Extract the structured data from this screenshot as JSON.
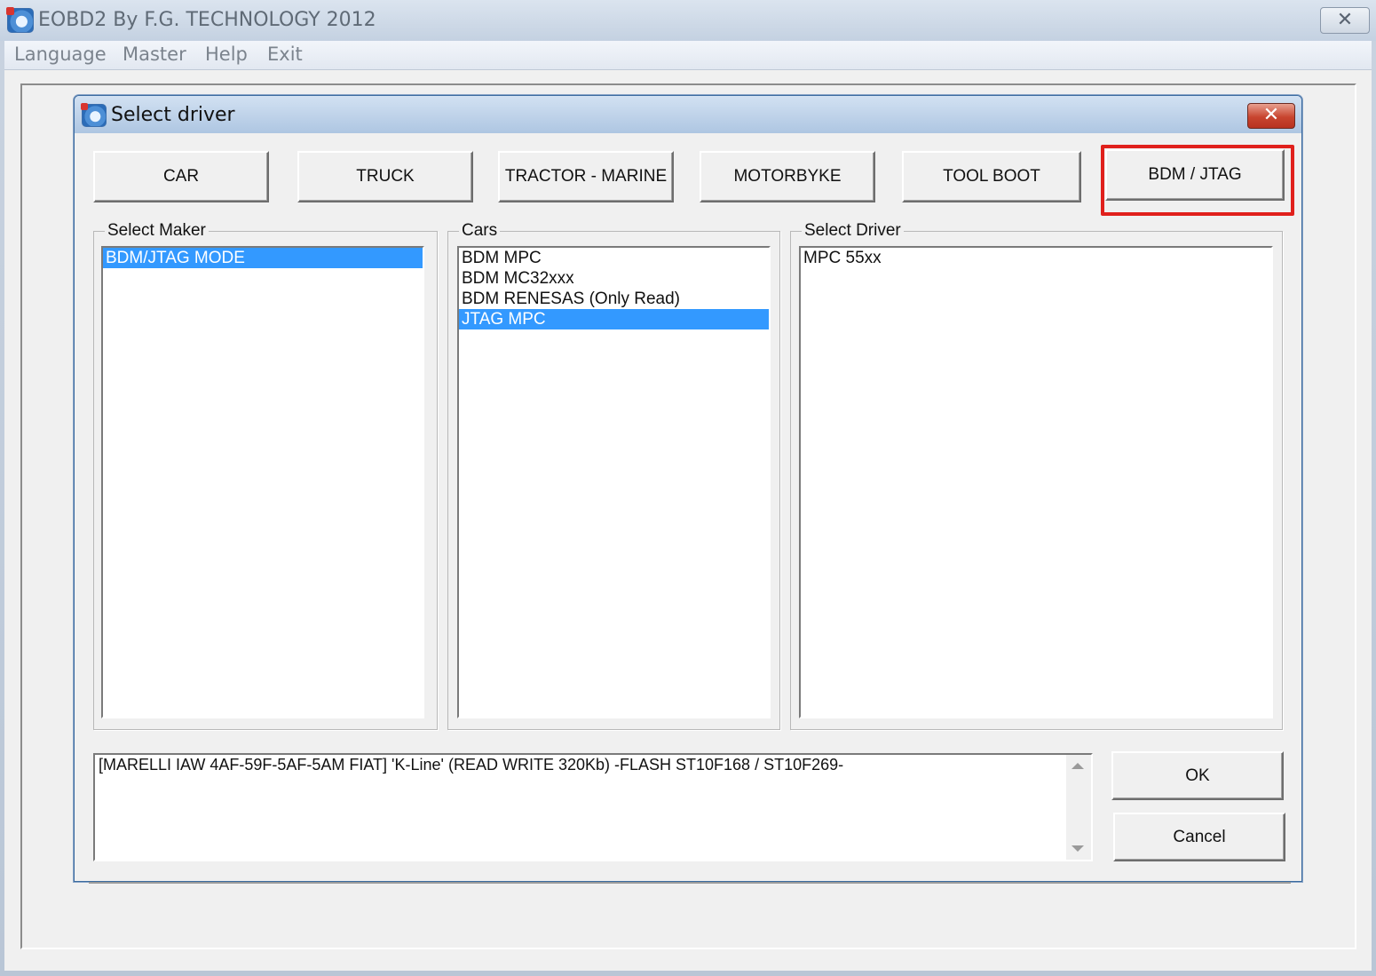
{
  "window": {
    "title": "EOBD2 By F.G. TECHNOLOGY 2012",
    "close_glyph": "✕"
  },
  "menu": {
    "items": [
      {
        "label": "Language"
      },
      {
        "label": "Master"
      },
      {
        "label": "Help"
      },
      {
        "label": "Exit"
      }
    ]
  },
  "dialog": {
    "title": "Select driver",
    "close_glyph": "✕",
    "category_buttons": [
      {
        "label": "CAR"
      },
      {
        "label": "TRUCK"
      },
      {
        "label": "TRACTOR - MARINE"
      },
      {
        "label": "MOTORBYKE"
      },
      {
        "label": "TOOL BOOT"
      },
      {
        "label": "BDM / JTAG",
        "highlighted": true
      }
    ],
    "maker_group": {
      "label": "Select Maker",
      "items": [
        {
          "label": "BDM/JTAG  MODE",
          "selected": true
        }
      ]
    },
    "cars_group": {
      "label": "Cars",
      "items": [
        {
          "label": "BDM MPC"
        },
        {
          "label": "BDM MC32xxx"
        },
        {
          "label": "BDM RENESAS (Only Read)"
        },
        {
          "label": "JTAG MPC",
          "selected": true
        }
      ]
    },
    "driver_group": {
      "label": "Select Driver",
      "items": [
        {
          "label": "MPC 55xx"
        }
      ]
    },
    "description": "[MARELLI IAW 4AF-59F-5AF-5AM FIAT]  'K-Line' (READ WRITE 320Kb)  -FLASH ST10F168 / ST10F269-",
    "ok_label": "OK",
    "cancel_label": "Cancel"
  },
  "colors": {
    "selection": "#3399ff",
    "highlight_frame": "#e0201c"
  }
}
